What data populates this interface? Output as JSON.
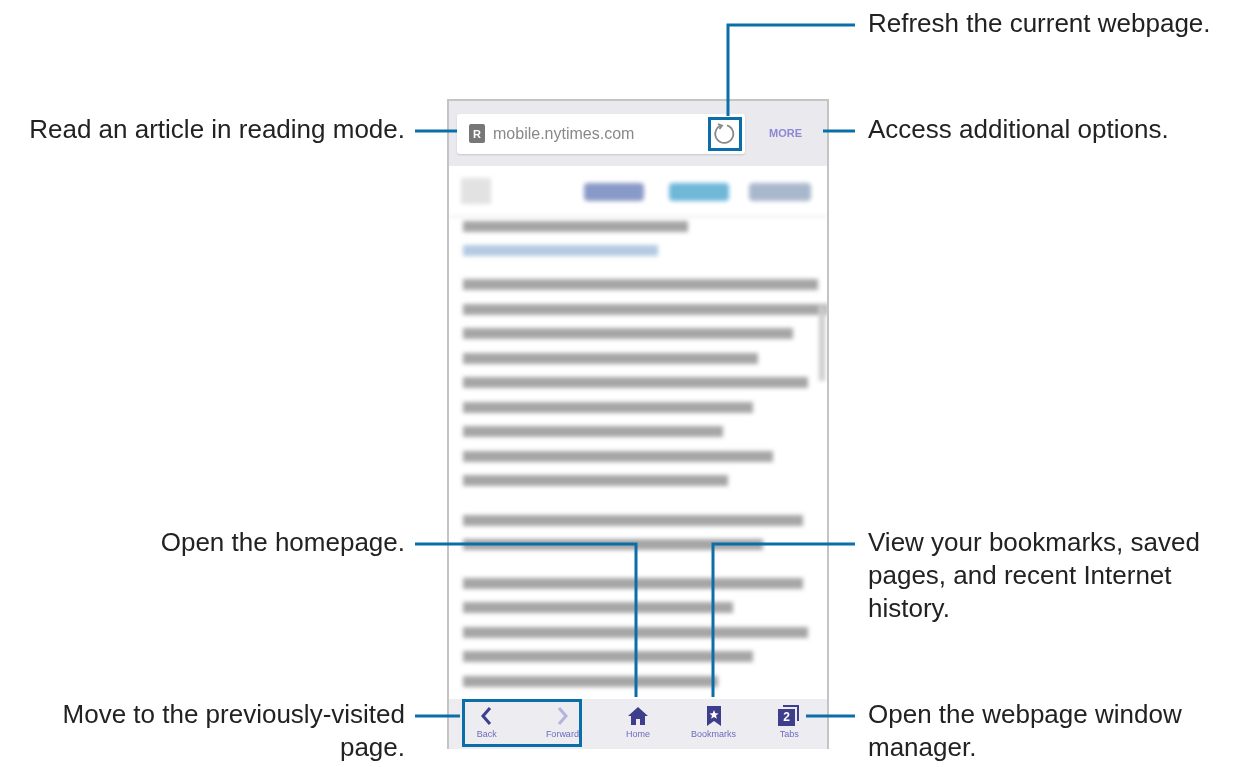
{
  "phone": {
    "address_bar": {
      "reader_badge": "R",
      "url": "mobile.nytimes.com",
      "more": "MORE"
    },
    "bottom_bar": [
      {
        "kind": "back",
        "label": "Back",
        "disabled": false
      },
      {
        "kind": "forward",
        "label": "Forward",
        "disabled": true
      },
      {
        "kind": "home",
        "label": "Home"
      },
      {
        "kind": "bookmarks",
        "label": "Bookmarks"
      },
      {
        "kind": "tabs",
        "label": "Tabs",
        "count": "2"
      }
    ]
  },
  "callouts": [
    {
      "kind": "refresh",
      "text": "Refresh the current webpage."
    },
    {
      "kind": "reader",
      "text": "Read an article in reading mode."
    },
    {
      "kind": "more",
      "text": "Access additional options."
    },
    {
      "kind": "home",
      "text": "Open the homepage."
    },
    {
      "kind": "bookmarks",
      "text": "View your bookmarks, saved pages, and recent Internet history."
    },
    {
      "kind": "backforward",
      "text": "Move to the previously-visited page."
    },
    {
      "kind": "tabs",
      "text": "Open the webpage window manager."
    }
  ]
}
